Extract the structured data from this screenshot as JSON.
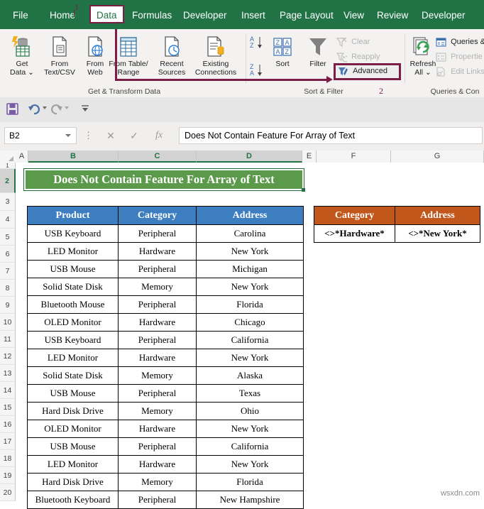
{
  "ribbon": {
    "tabs": [
      {
        "label": "File",
        "active": false
      },
      {
        "label": "Home",
        "active": false
      },
      {
        "label": "Data",
        "active": true
      },
      {
        "label": "Formulas",
        "active": false
      },
      {
        "label": "Developer",
        "active": false
      },
      {
        "label": "Insert",
        "active": false
      },
      {
        "label": "Page Layout",
        "active": false
      },
      {
        "label": "View",
        "active": false
      },
      {
        "label": "Review",
        "active": false
      },
      {
        "label": "Developer",
        "active": false
      }
    ],
    "callouts": {
      "step1": "1",
      "step2": "2"
    },
    "groups": {
      "get_transform": "Get & Transform Data",
      "sort_filter": "Sort & Filter",
      "queries": "Queries & Con"
    },
    "buttons": {
      "get_data_l1": "Get",
      "get_data_l2": "Data ⌄",
      "from_text_l1": "From",
      "from_text_l2": "Text/CSV",
      "from_web_l1": "From",
      "from_web_l2": "Web",
      "from_table_l1": "From Table/",
      "from_table_l2": "Range",
      "recent_l1": "Recent",
      "recent_l2": "Sources",
      "existing_l1": "Existing",
      "existing_l2": "Connections",
      "sort": "Sort",
      "filter": "Filter",
      "clear": "Clear",
      "reapply": "Reapply",
      "advanced": "Advanced",
      "refresh_l1": "Refresh",
      "refresh_l2": "All ⌄",
      "queries_conn": "Queries &",
      "properties": "Propertie",
      "edit_links": "Edit Links"
    }
  },
  "formula_bar": {
    "name_box": "B2",
    "cancel_icon": "✕",
    "enter_icon": "✓",
    "fx_icon": "fx",
    "value": "Does Not Contain Feature For Array of Text"
  },
  "grid": {
    "column_letters": [
      "A",
      "B",
      "C",
      "D",
      "E",
      "F",
      "G"
    ],
    "selected_columns": [
      "B",
      "C",
      "D"
    ],
    "row_numbers": [
      "1",
      "2",
      "3",
      "4",
      "5",
      "6",
      "7",
      "8",
      "9",
      "10",
      "11",
      "12",
      "13",
      "14",
      "15",
      "16",
      "17",
      "18",
      "19",
      "20"
    ],
    "selected_row": "2"
  },
  "title_cell": {
    "text": "Does Not Contain Feature For Array of Text",
    "bg": "#5c9a4b",
    "color": "#ffffff"
  },
  "data_table": {
    "headers": [
      "Product",
      "Category",
      "Address"
    ],
    "header_bg": "#3d7ec0",
    "rows": [
      [
        "USB Keyboard",
        "Peripheral",
        "Carolina"
      ],
      [
        "LED Monitor",
        "Hardware",
        "New York"
      ],
      [
        "USB Mouse",
        "Peripheral",
        "Michigan"
      ],
      [
        "Solid State Disk",
        "Memory",
        "New York"
      ],
      [
        "Bluetooth Mouse",
        "Peripheral",
        "Florida"
      ],
      [
        "OLED Monitor",
        "Hardware",
        "Chicago"
      ],
      [
        "USB Keyboard",
        "Peripheral",
        "California"
      ],
      [
        "LED Monitor",
        "Hardware",
        "New York"
      ],
      [
        "Solid State Disk",
        "Memory",
        "Alaska"
      ],
      [
        "USB Mouse",
        "Peripheral",
        "Texas"
      ],
      [
        "Hard Disk Drive",
        "Memory",
        "Ohio"
      ],
      [
        "OLED Monitor",
        "Hardware",
        "New York"
      ],
      [
        "USB Mouse",
        "Peripheral",
        "California"
      ],
      [
        "LED Monitor",
        "Hardware",
        "New York"
      ],
      [
        "Hard Disk Drive",
        "Memory",
        "Florida"
      ],
      [
        "Bluetooth Keyboard",
        "Peripheral",
        "New Hampshire"
      ]
    ]
  },
  "criteria_table": {
    "headers": [
      "Category",
      "Address"
    ],
    "header_bg": "#c2571b",
    "rows": [
      [
        "<>*Hardware*",
        "<>*New York*"
      ]
    ]
  },
  "watermark": "wsxdn.com"
}
